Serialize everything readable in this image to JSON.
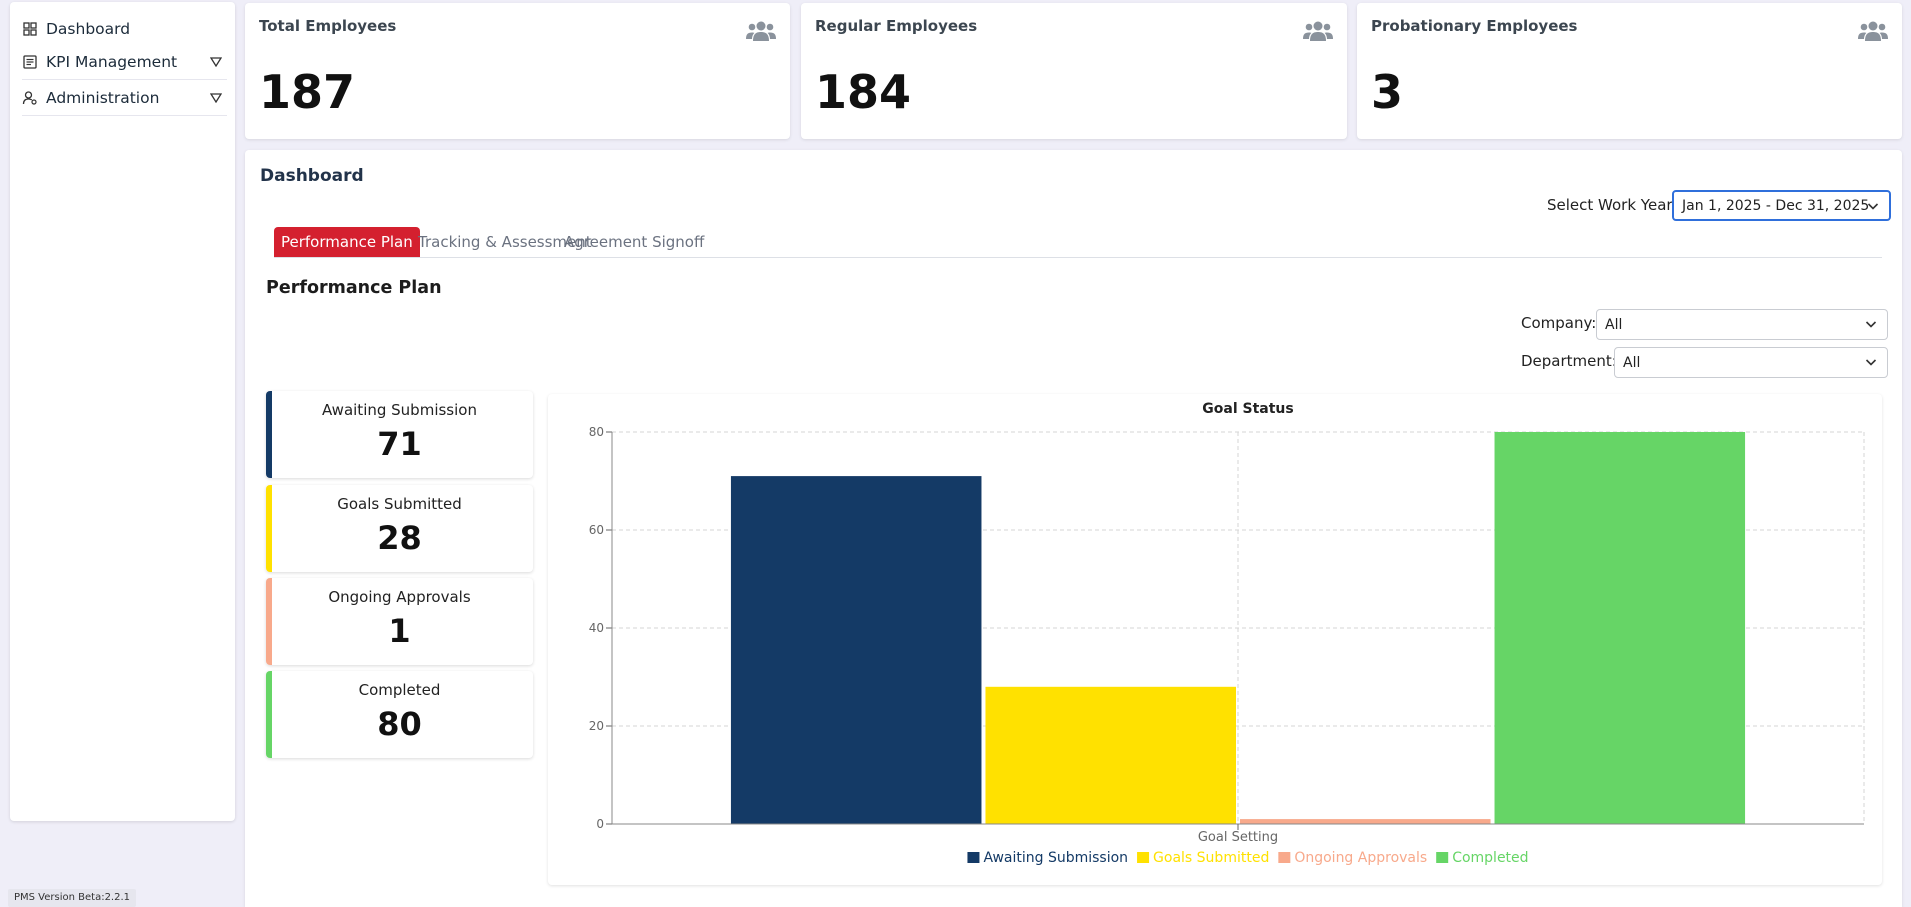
{
  "sidebar": {
    "items": [
      {
        "label": "Dashboard",
        "icon": "grid-icon",
        "has_caret": false
      },
      {
        "label": "KPI Management",
        "icon": "list-icon",
        "has_caret": true
      },
      {
        "label": "Administration",
        "icon": "user-gear-icon",
        "has_caret": true
      }
    ]
  },
  "version": "PMS Version Beta:2.2.1",
  "stats": [
    {
      "title": "Total Employees",
      "value": "187",
      "icon": "users-icon"
    },
    {
      "title": "Regular Employees",
      "value": "184",
      "icon": "users-icon"
    },
    {
      "title": "Probationary Employees",
      "value": "3",
      "icon": "users-icon"
    }
  ],
  "main": {
    "title": "Dashboard",
    "work_year_label": "Select Work Year:",
    "work_year_value": "Jan 1, 2025 - Dec 31, 2025",
    "tabs": [
      {
        "label": "Performance Plan",
        "active": true
      },
      {
        "label": "Tracking & Assessment",
        "active": false
      },
      {
        "label": "Agreement Signoff",
        "active": false
      }
    ],
    "section_title": "Performance Plan",
    "company_label": "Company:",
    "company_value": "All",
    "department_label": "Department:",
    "department_value": "All"
  },
  "status_cards": [
    {
      "label": "Awaiting Submission",
      "value": "71",
      "color": "#143a66"
    },
    {
      "label": "Goals Submitted",
      "value": "28",
      "color": "#ffe100"
    },
    {
      "label": "Ongoing Approvals",
      "value": "1",
      "color": "#f8a98b"
    },
    {
      "label": "Completed",
      "value": "80",
      "color": "#66d566"
    }
  ],
  "chart_data": {
    "type": "bar",
    "title": "Goal Status",
    "categories": [
      "Goal Setting"
    ],
    "series": [
      {
        "name": "Awaiting Submission",
        "values": [
          71
        ],
        "color": "#143a66"
      },
      {
        "name": "Goals Submitted",
        "values": [
          28
        ],
        "color": "#ffe100"
      },
      {
        "name": "Ongoing Approvals",
        "values": [
          1
        ],
        "color": "#f8a98b"
      },
      {
        "name": "Completed",
        "values": [
          80
        ],
        "color": "#66d566"
      }
    ],
    "ylim": [
      0,
      80
    ],
    "yticks": [
      0,
      20,
      40,
      60,
      80
    ],
    "grid": true,
    "legend": "bottom"
  }
}
